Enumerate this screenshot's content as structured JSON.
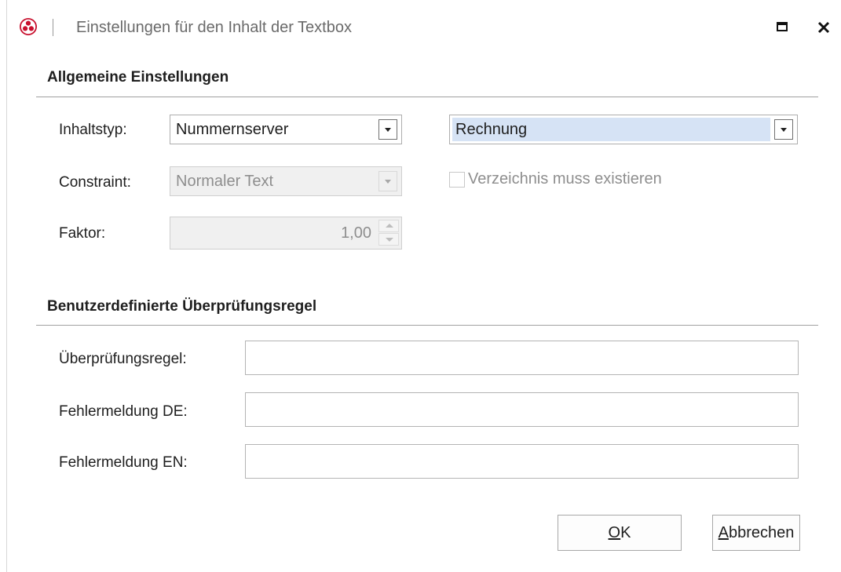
{
  "window": {
    "title": "Einstellungen für den Inhalt der Textbox",
    "accent_color": "#c8102e"
  },
  "general": {
    "section_title": "Allgemeine Einstellungen",
    "content_type": {
      "label": "Inhaltstyp:",
      "value": "Nummernserver",
      "secondary_value": "Rechnung"
    },
    "constraint": {
      "label": "Constraint:",
      "value": "Normaler Text",
      "checkbox_label": "Verzeichnis muss existieren",
      "checkbox_checked": false
    },
    "factor": {
      "label": "Faktor:",
      "value": "1,00"
    }
  },
  "validation": {
    "section_title": "Benutzerdefinierte Überprüfungsregel",
    "rule": {
      "label": "Überprüfungsregel:",
      "value": ""
    },
    "error_de": {
      "label": "Fehlermeldung DE:",
      "value": ""
    },
    "error_en": {
      "label": "Fehlermeldung EN:",
      "value": ""
    }
  },
  "buttons": {
    "ok_mnemonic": "O",
    "ok_rest": "K",
    "cancel_mnemonic": "A",
    "cancel_rest": "bbrechen"
  }
}
